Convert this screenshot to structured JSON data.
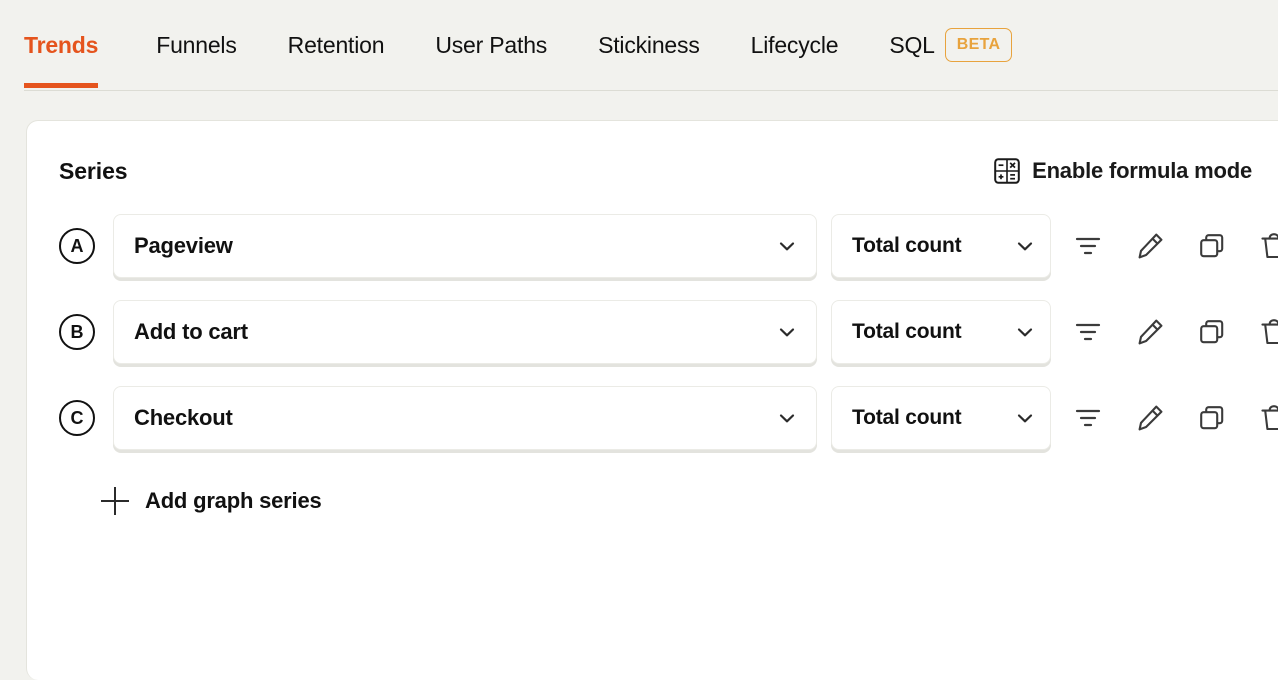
{
  "tabs": [
    {
      "label": "Trends",
      "active": true
    },
    {
      "label": "Funnels",
      "active": false
    },
    {
      "label": "Retention",
      "active": false
    },
    {
      "label": "User Paths",
      "active": false
    },
    {
      "label": "Stickiness",
      "active": false
    },
    {
      "label": "Lifecycle",
      "active": false
    },
    {
      "label": "SQL",
      "active": false
    }
  ],
  "badges": {
    "beta": "BETA"
  },
  "card": {
    "title": "Series",
    "formula_mode": {
      "label": "Enable formula mode",
      "icon": "formula-calculator-icon"
    },
    "series": [
      {
        "letter": "A",
        "event": "Pageview",
        "math": "Total count",
        "actions": [
          "filter-icon",
          "edit-pencil-icon",
          "duplicate-icon",
          "trash-icon"
        ]
      },
      {
        "letter": "B",
        "event": "Add to cart",
        "math": "Total count",
        "actions": [
          "filter-icon",
          "edit-pencil-icon",
          "duplicate-icon",
          "trash-icon"
        ]
      },
      {
        "letter": "C",
        "event": "Checkout",
        "math": "Total count",
        "actions": [
          "filter-icon",
          "edit-pencil-icon",
          "duplicate-icon",
          "trash-icon"
        ]
      }
    ],
    "add_series_label": "Add graph series"
  },
  "colors": {
    "accent": "#e5541d",
    "beta": "#e8a33d",
    "page_background": "#f2f2ee",
    "card_background": "#ffffff",
    "text": "#111111"
  }
}
